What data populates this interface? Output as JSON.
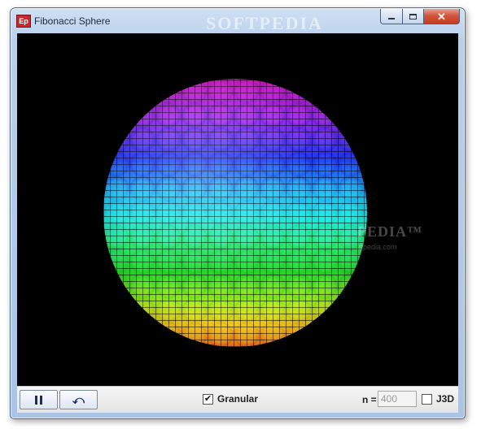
{
  "window": {
    "title": "Fibonacci Sphere",
    "app_icon_text": "Ep",
    "watermark": "SOFTPEDIA",
    "buttons": {
      "minimize": "minimize",
      "maximize": "maximize",
      "close": "✕"
    }
  },
  "canvas": {
    "watermark_text": "PEDIA™",
    "watermark_url": "ftpedia.com",
    "sphere_colors": [
      "#d41cc4",
      "#8a2ae6",
      "#2038f0",
      "#22b8f2",
      "#20e6e0",
      "#2ae88a",
      "#25d42a",
      "#a8e620",
      "#f0c420",
      "#f07820"
    ]
  },
  "controls": {
    "pause_icon": "pause-icon",
    "reset_icon": "undo-arrow-icon",
    "reset_glyph": "⤺",
    "granular": {
      "label": "Granular",
      "checked": true,
      "check_glyph": "✔"
    },
    "n": {
      "label": "n =",
      "value": "400"
    },
    "j3d": {
      "label": "J3D",
      "checked": false
    }
  }
}
